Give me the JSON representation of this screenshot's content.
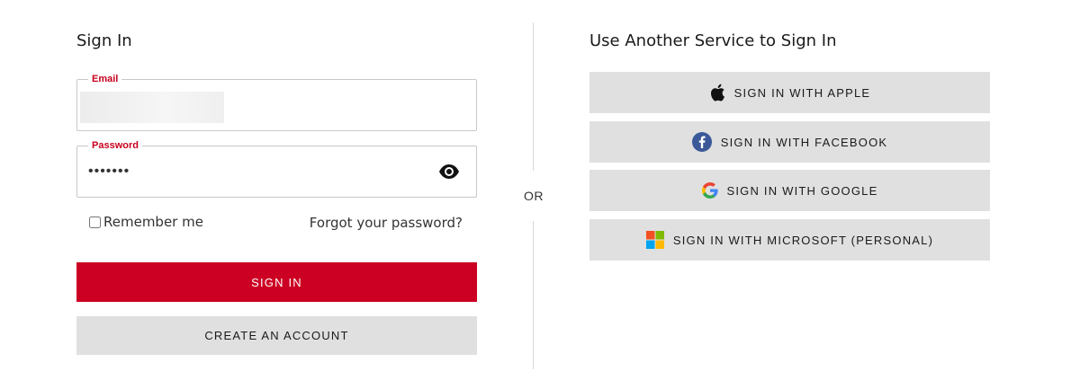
{
  "sign_in": {
    "heading": "Sign In",
    "email": {
      "label": "Email",
      "value": ""
    },
    "password": {
      "label": "Password",
      "value": "•••••••"
    },
    "remember_label": "Remember me",
    "forgot_label": "Forgot your password?",
    "sign_in_label": "SIGN IN",
    "create_account_label": "CREATE AN ACCOUNT"
  },
  "divider": {
    "label": "OR"
  },
  "services": {
    "heading": "Use Another Service to Sign In",
    "apple_label": "SIGN IN WITH APPLE",
    "facebook_label": "SIGN IN WITH FACEBOOK",
    "google_label": "SIGN IN WITH GOOGLE",
    "microsoft_label": "SIGN IN WITH MICROSOFT (PERSONAL)"
  },
  "colors": {
    "accent": "#cc0022",
    "label_red": "#c8001e",
    "button_gray": "#e0e0e0",
    "facebook_blue": "#3b5998"
  },
  "icons": [
    "eye-icon",
    "apple-icon",
    "facebook-icon",
    "google-icon",
    "microsoft-icon"
  ]
}
